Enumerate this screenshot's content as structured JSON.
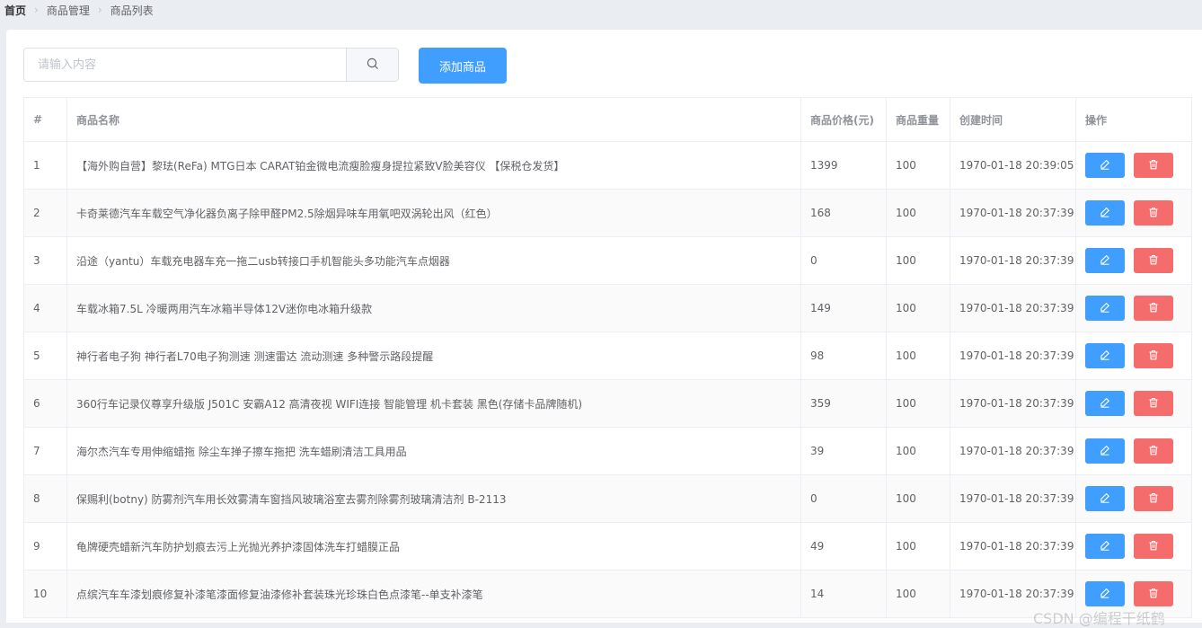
{
  "breadcrumb": {
    "home": "首页",
    "level2": "商品管理",
    "level3": "商品列表"
  },
  "search": {
    "placeholder": "请输入内容",
    "value": ""
  },
  "toolbar": {
    "add_label": "添加商品"
  },
  "table": {
    "headers": [
      "#",
      "商品名称",
      "商品价格(元)",
      "商品重量",
      "创建时间",
      "操作"
    ],
    "rows": [
      {
        "index": "1",
        "name": "【海外购自营】黎珐(ReFa) MTG日本 CARAT铂金微电流瘦脸瘦身提拉紧致V脸美容仪 【保税仓发货】",
        "price": "1399",
        "weight": "100",
        "time": "1970-01-18 20:39:05"
      },
      {
        "index": "2",
        "name": "卡奇莱德汽车车载空气净化器负离子除甲醛PM2.5除烟异味车用氧吧双涡轮出风（红色）",
        "price": "168",
        "weight": "100",
        "time": "1970-01-18 20:37:39"
      },
      {
        "index": "3",
        "name": "沿途（yantu）车载充电器车充一拖二usb转接口手机智能头多功能汽车点烟器",
        "price": "0",
        "weight": "100",
        "time": "1970-01-18 20:37:39"
      },
      {
        "index": "4",
        "name": "车载冰箱7.5L 冷暖两用汽车冰箱半导体12V迷你电冰箱升级款",
        "price": "149",
        "weight": "100",
        "time": "1970-01-18 20:37:39"
      },
      {
        "index": "5",
        "name": "神行者电子狗 神行者L70电子狗测速 测速雷达 流动测速 多种警示路段提醒",
        "price": "98",
        "weight": "100",
        "time": "1970-01-18 20:37:39"
      },
      {
        "index": "6",
        "name": "360行车记录仪尊享升级版 J501C 安霸A12 高清夜视 WIFI连接 智能管理 机卡套装 黑色(存储卡品牌随机)",
        "price": "359",
        "weight": "100",
        "time": "1970-01-18 20:37:39"
      },
      {
        "index": "7",
        "name": "海尔杰汽车专用伸缩蜡拖 除尘车掸子擦车拖把 洗车蜡刷清洁工具用品",
        "price": "39",
        "weight": "100",
        "time": "1970-01-18 20:37:39"
      },
      {
        "index": "8",
        "name": "保赐利(botny) 防雾剂汽车用长效雾清车窗挡风玻璃浴室去雾剂除雾剂玻璃清洁剂 B-2113",
        "price": "0",
        "weight": "100",
        "time": "1970-01-18 20:37:39"
      },
      {
        "index": "9",
        "name": "龟牌硬壳蜡新汽车防护划痕去污上光抛光养护漆固体洗车打蜡膜正品",
        "price": "49",
        "weight": "100",
        "time": "1970-01-18 20:37:39"
      },
      {
        "index": "10",
        "name": "点缤汽车车漆划痕修复补漆笔漆面修复油漆修补套装珠光珍珠白色点漆笔--单支补漆笔",
        "price": "14",
        "weight": "100",
        "time": "1970-01-18 20:37:39"
      }
    ]
  },
  "icons": {
    "search": "search-icon",
    "edit": "edit-icon",
    "delete": "delete-icon"
  },
  "colors": {
    "primary": "#409eff",
    "danger": "#f56c6c"
  },
  "watermark": "CSDN @编程干纸鹤"
}
